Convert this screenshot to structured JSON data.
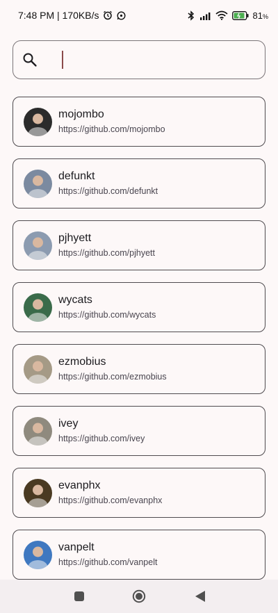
{
  "status_bar": {
    "time_speed": "7:48 PM | 170KB/s",
    "battery": "81",
    "battery_suffix": "%",
    "icons": [
      "alarm-icon",
      "whatsapp-icon",
      "bluetooth-icon",
      "signal-icon",
      "wifi-icon",
      "battery-icon"
    ]
  },
  "search": {
    "value": "",
    "placeholder": "",
    "icon": "search-icon"
  },
  "users": [
    {
      "login": "mojombo",
      "url": "https://github.com/mojombo",
      "avatar_color": "#2b2b2b"
    },
    {
      "login": "defunkt",
      "url": "https://github.com/defunkt",
      "avatar_color": "#7b8aa0"
    },
    {
      "login": "pjhyett",
      "url": "https://github.com/pjhyett",
      "avatar_color": "#8c9bb0"
    },
    {
      "login": "wycats",
      "url": "https://github.com/wycats",
      "avatar_color": "#3a6b4a"
    },
    {
      "login": "ezmobius",
      "url": "https://github.com/ezmobius",
      "avatar_color": "#a59a86"
    },
    {
      "login": "ivey",
      "url": "https://github.com/ivey",
      "avatar_color": "#8f8a7e"
    },
    {
      "login": "evanphx",
      "url": "https://github.com/evanphx",
      "avatar_color": "#4a3a22"
    },
    {
      "login": "vanpelt",
      "url": "https://github.com/vanpelt",
      "avatar_color": "#3f78c0"
    }
  ],
  "nav_bar": {
    "icons": [
      "recent-apps-icon",
      "home-icon",
      "back-icon"
    ]
  }
}
